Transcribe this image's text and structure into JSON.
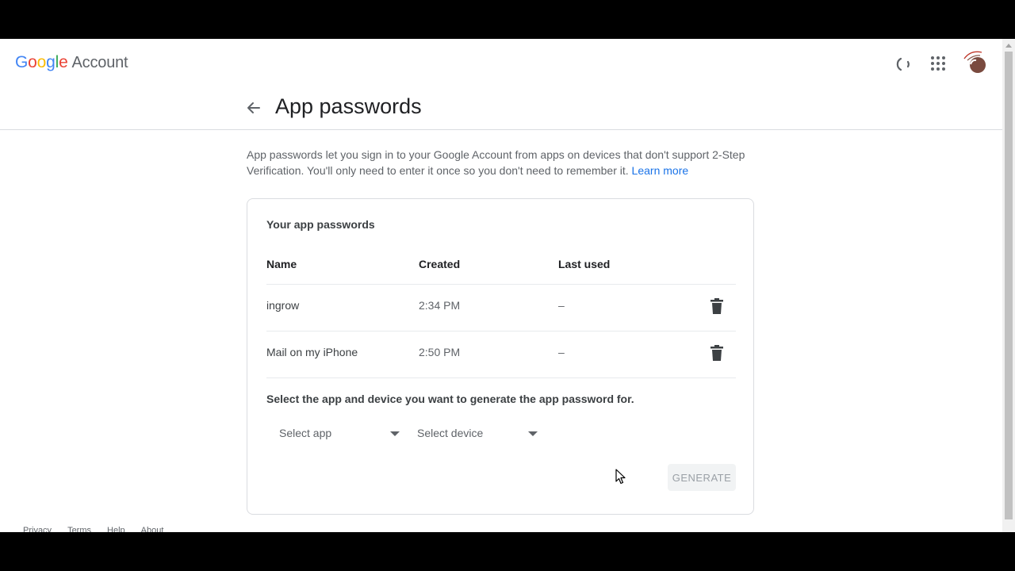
{
  "header": {
    "logo_parts": [
      "G",
      "o",
      "o",
      "g",
      "l",
      "e"
    ],
    "logo_suffix": "Account"
  },
  "page": {
    "title": "App passwords",
    "description": "App passwords let you sign in to your Google Account from apps on devices that don't support 2-Step Verification. You'll only need to enter it once so you don't need to remember it.",
    "learn_more": "Learn more"
  },
  "card": {
    "title": "Your app passwords",
    "columns": [
      "Name",
      "Created",
      "Last used"
    ],
    "rows": [
      {
        "name": "ingrow",
        "created": "2:34 PM",
        "last_used": "–"
      },
      {
        "name": "Mail on my iPhone",
        "created": "2:50 PM",
        "last_used": "–"
      }
    ],
    "select_help": "Select the app and device you want to generate the app password for.",
    "select_app": "Select app",
    "select_device": "Select device",
    "generate": "GENERATE"
  },
  "footer": {
    "links": [
      "Privacy",
      "Terms",
      "Help",
      "About"
    ]
  },
  "icons": {
    "back": "arrow-left-icon",
    "apps": "apps-grid-icon",
    "trash": "trash-icon",
    "spinner": "loading-spinner-icon"
  },
  "colors": {
    "blue": "#4285F4",
    "red": "#EA4335",
    "yellow": "#FBBC05",
    "green": "#34A853",
    "link": "#1a73e8"
  }
}
